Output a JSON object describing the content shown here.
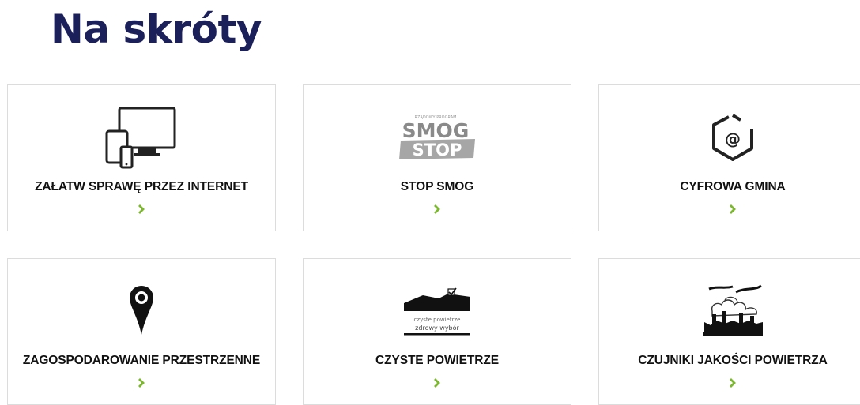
{
  "page": {
    "title": "Na skróty"
  },
  "colors": {
    "title": "#1b1f5a",
    "chevron": "#7cb82f",
    "border": "#dcdcdc"
  },
  "tiles": [
    {
      "label": "ZAŁATW SPRAWĘ PRZEZ INTERNET",
      "icon": "devices-icon"
    },
    {
      "label": "STOP SMOG",
      "icon": "smog-stop-logo",
      "logo": {
        "top": "RZĄDOWY PROGRAM",
        "smog": "SMOG",
        "stop": "STOP"
      }
    },
    {
      "label": "CYFROWA GMINA",
      "icon": "at-hexagon-icon",
      "glyph": "@"
    },
    {
      "label": "ZAGOSPODAROWANIE PRZESTRZENNE",
      "icon": "map-pin-icon"
    },
    {
      "label": "CZYSTE POWIETRZE",
      "icon": "czyste-powietrze-logo",
      "logo": {
        "line1": "czyste powietrze",
        "line2": "zdrowy wybór"
      }
    },
    {
      "label": "CZUJNIKI JAKOŚCI POWIETRZA",
      "icon": "factory-pollution-icon"
    }
  ]
}
